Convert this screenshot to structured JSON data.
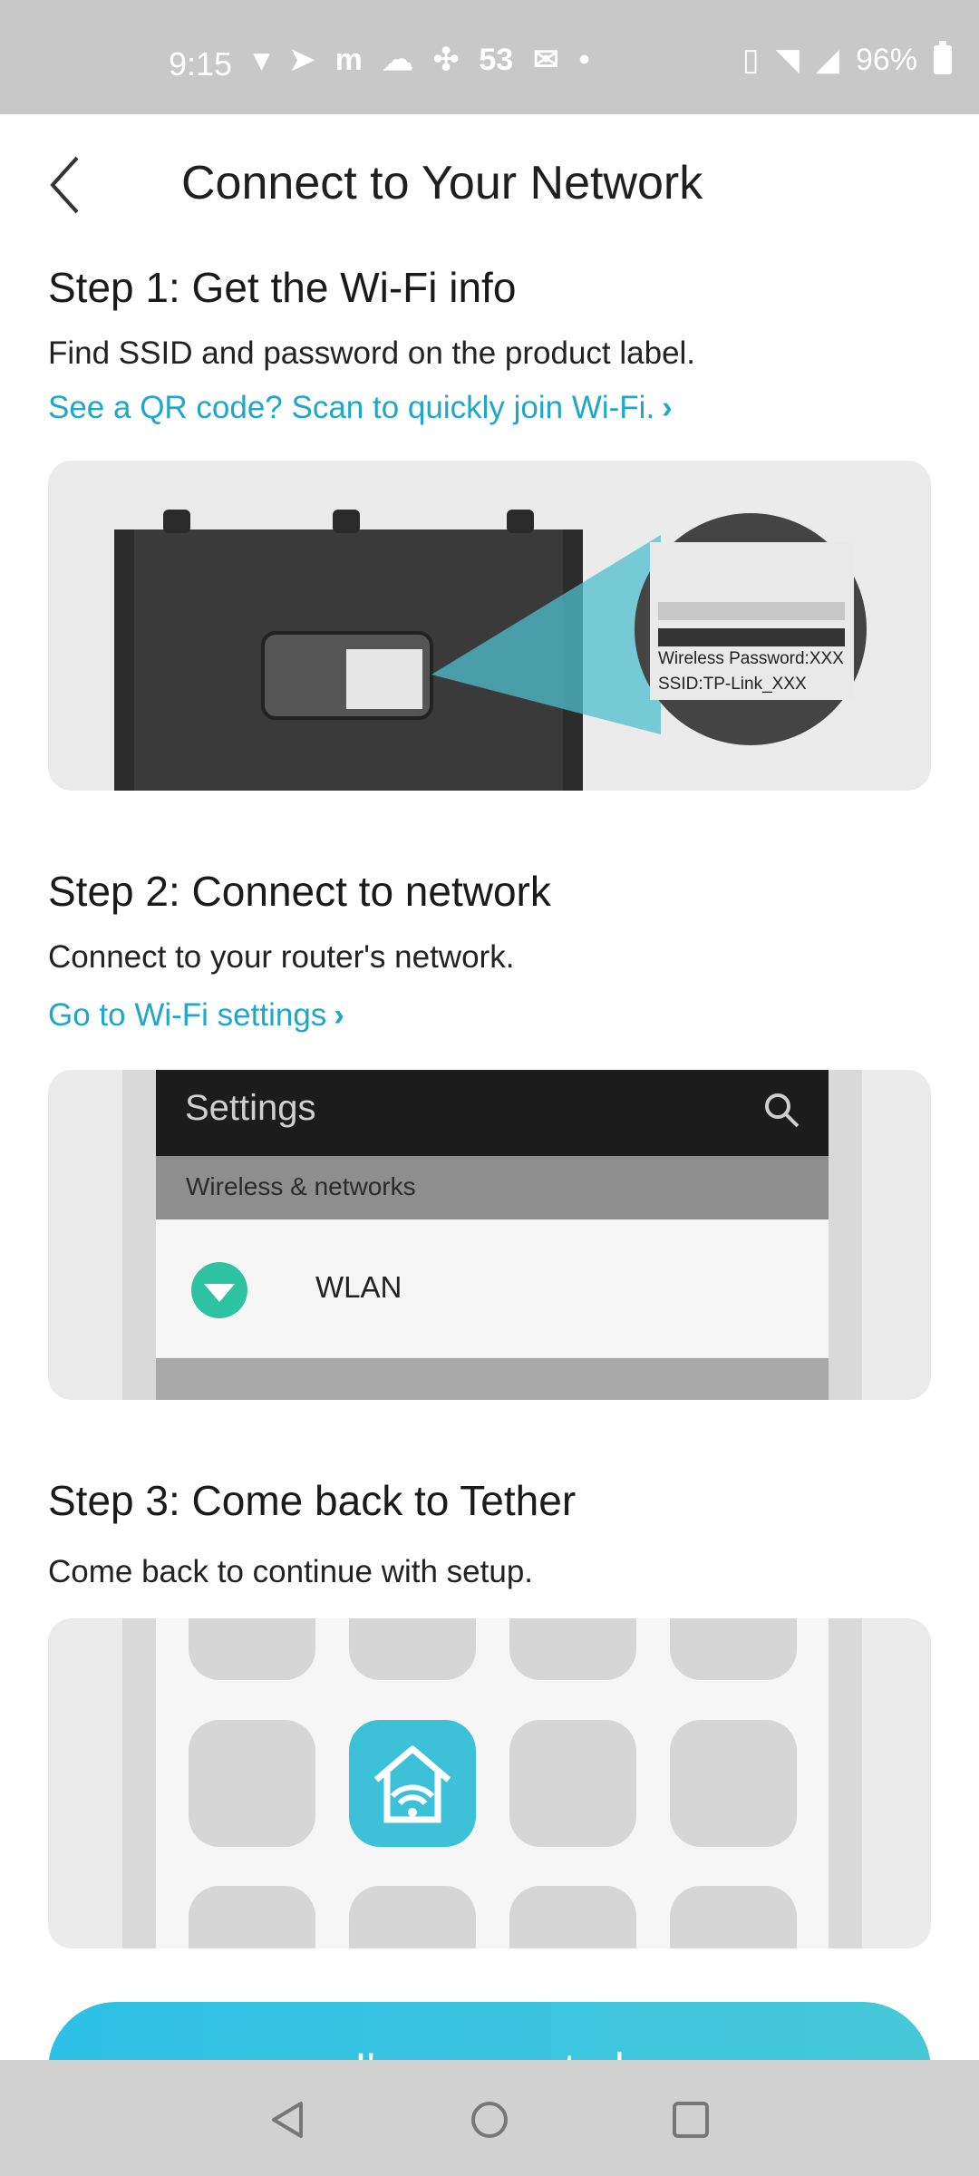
{
  "status_bar": {
    "time": "9:15",
    "notification_count": "53",
    "battery": "96%"
  },
  "header": {
    "title": "Connect to Your Network",
    "back_icon": "chevron-left-icon"
  },
  "steps": [
    {
      "title": "Step 1: Get the Wi-Fi info",
      "description": "Find SSID and password on the product label.",
      "link": "See a QR code? Scan to quickly join Wi-Fi.",
      "illustration": {
        "label_line_1": "Wireless Password:XXX",
        "label_line_2": "SSID:TP-Link_XXX"
      }
    },
    {
      "title": "Step 2: Connect to network",
      "description": "Connect to your router's network.",
      "link": "Go to Wi-Fi settings",
      "illustration": {
        "screen_title": "Settings",
        "section": "Wireless & networks",
        "item": "WLAN"
      }
    },
    {
      "title": "Step 3: Come back to Tether",
      "description": "Come back to continue with setup."
    }
  ],
  "primary_action": {
    "label": "I'm connected"
  },
  "colors": {
    "accent": "#1ea7c9",
    "button": "#2ec0e6",
    "wlan": "#2ec3a0",
    "tether": "#3cc1d8"
  }
}
